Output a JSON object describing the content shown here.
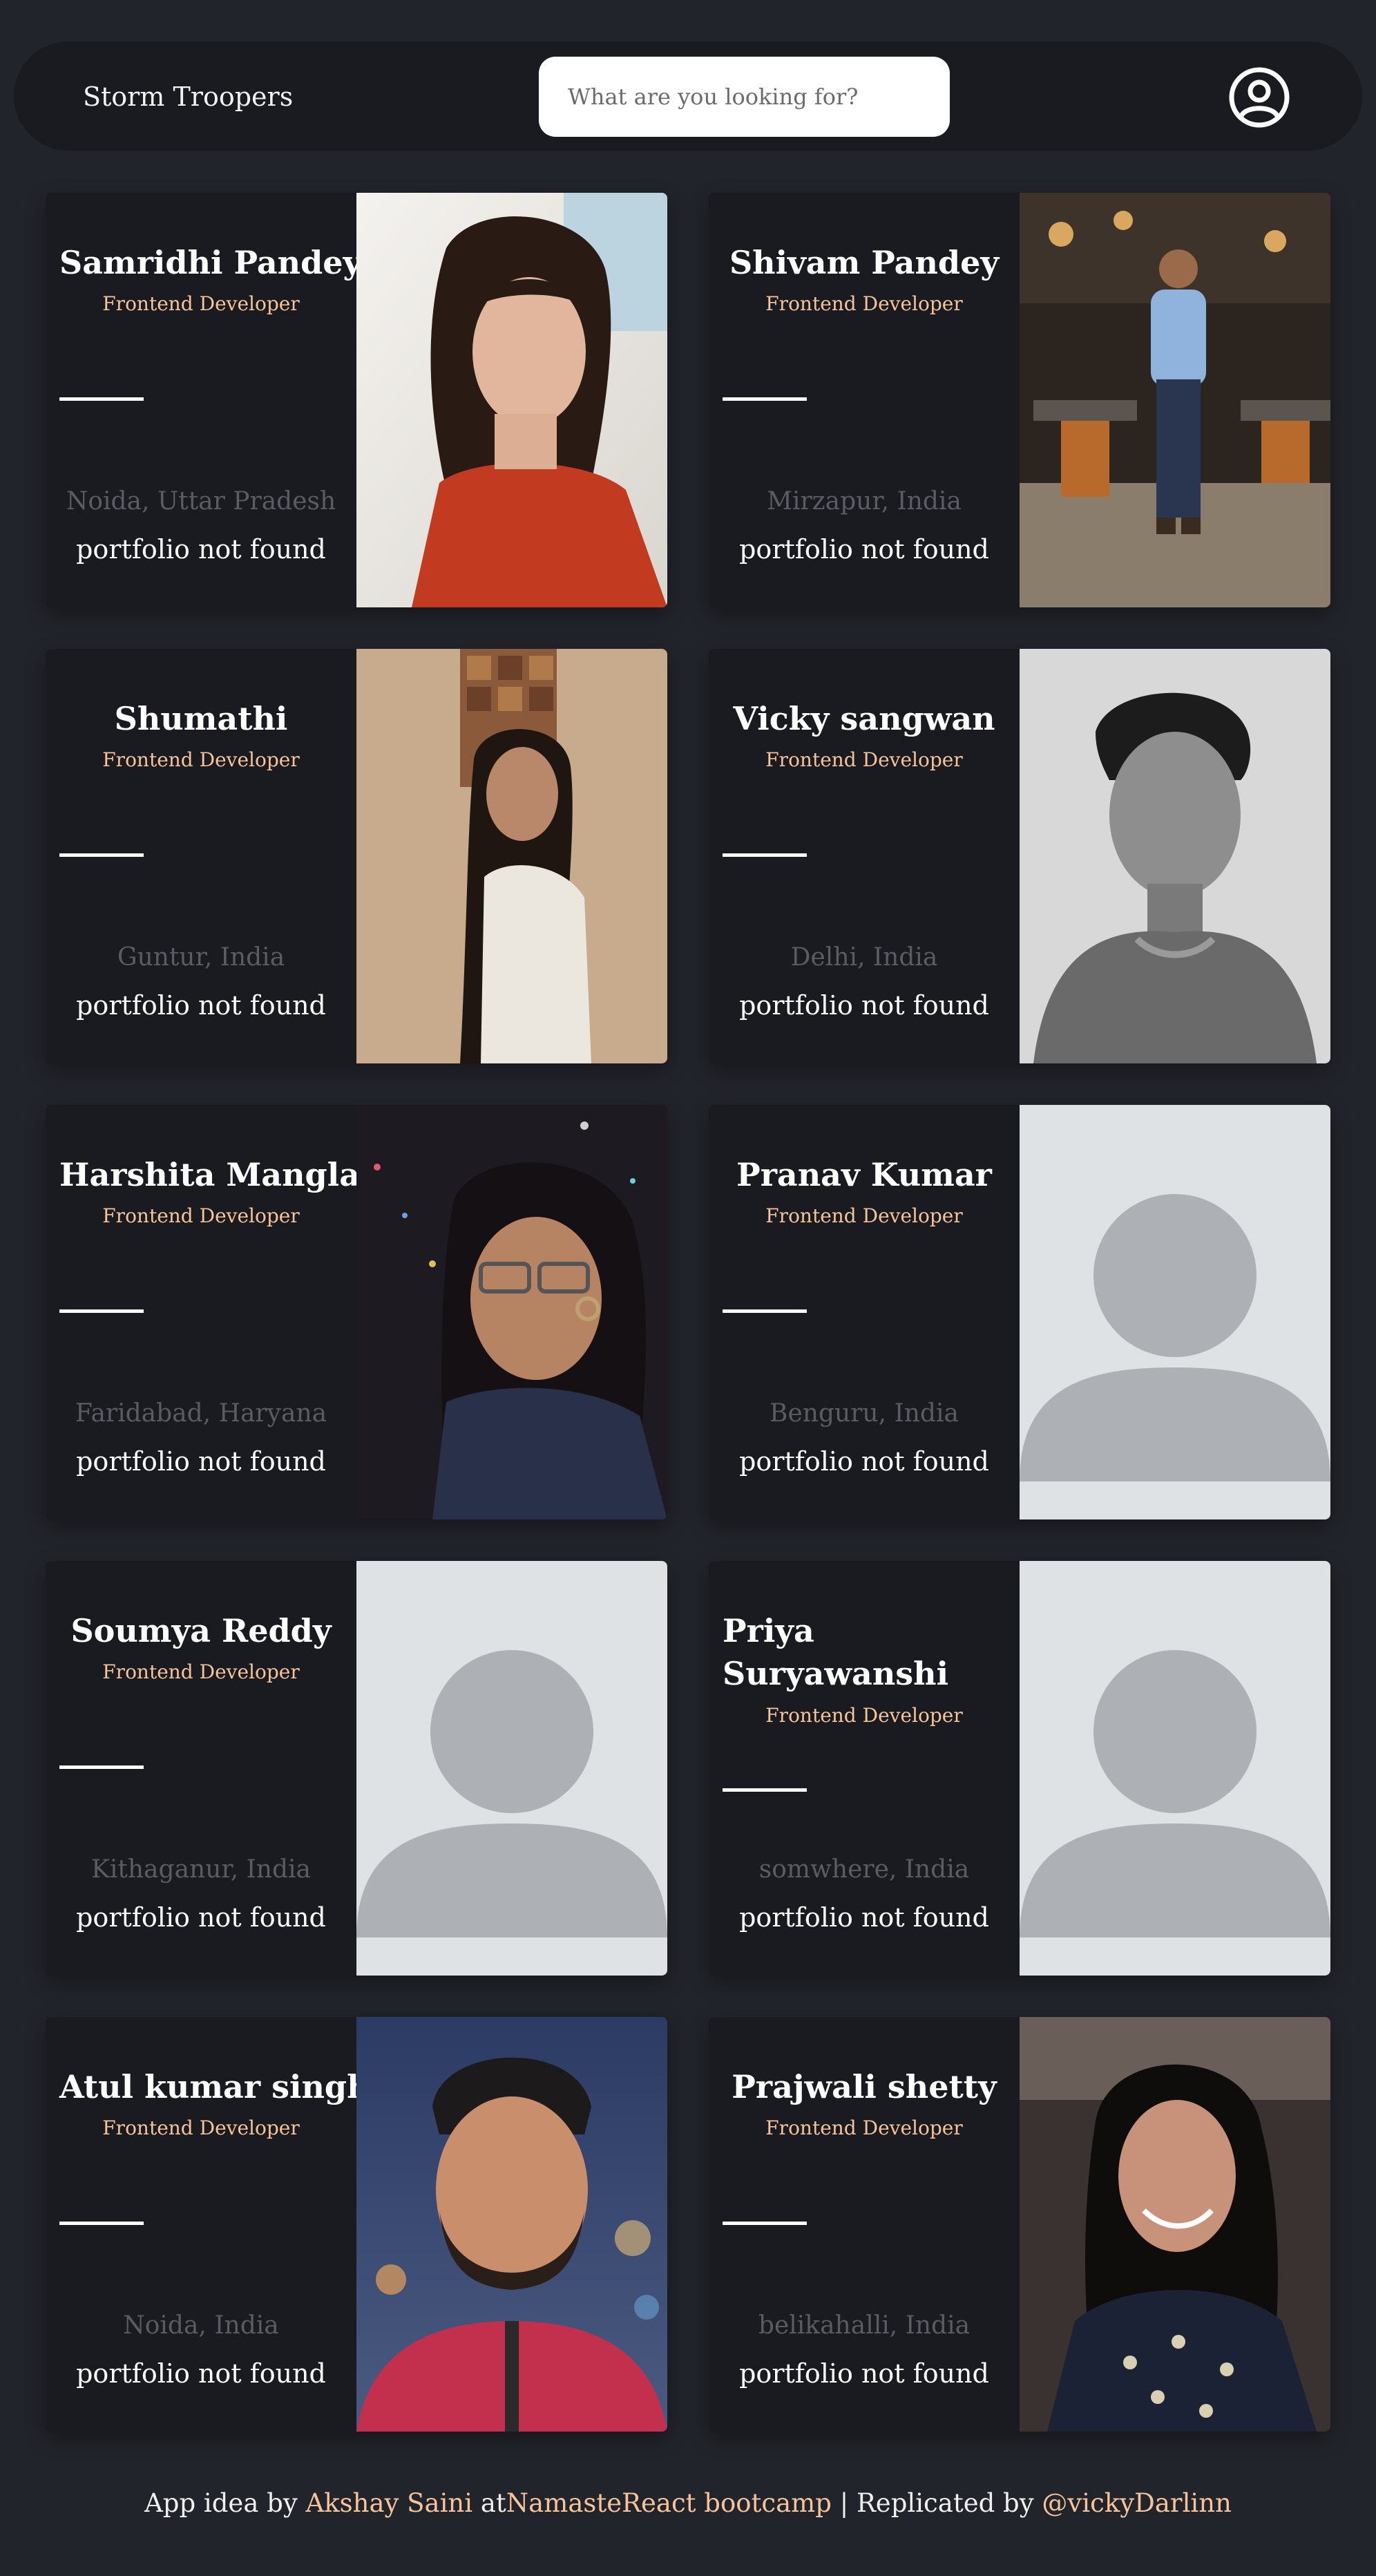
{
  "header": {
    "brand": "Storm Troopers",
    "search_placeholder": "What are you looking for?",
    "user_icon": "user-circle-icon"
  },
  "colors": {
    "background": "#22242b",
    "card": "#1a1b20",
    "accent": "#f7c49a",
    "muted": "#5a5c63"
  },
  "cards": [
    {
      "name": "Samridhi Pandey",
      "role": "Frontend Developer",
      "location": "Noida, Uttar Pradesh",
      "portfolio": "portfolio not found",
      "photo": "woman-portrait-red-top"
    },
    {
      "name": "Shivam Pandey",
      "role": "Frontend Developer",
      "location": "Mirzapur, India",
      "portfolio": "portfolio not found",
      "photo": "man-standing-restaurant"
    },
    {
      "name": "Shumathi",
      "role": "Frontend Developer",
      "location": "Guntur, India",
      "portfolio": "portfolio not found",
      "photo": "woman-portrait-beige-wall"
    },
    {
      "name": "Vicky sangwan",
      "role": "Frontend Developer",
      "location": "Delhi, India",
      "portfolio": "portfolio not found",
      "photo": "man-portrait-grayscale"
    },
    {
      "name": "Harshita Mangla",
      "role": "Frontend Developer",
      "location": "Faridabad, Haryana",
      "portfolio": "portfolio not found",
      "photo": "woman-glasses-night"
    },
    {
      "name": "Pranav Kumar",
      "role": "Frontend Developer",
      "location": "Benguru, India",
      "portfolio": "portfolio not found",
      "photo": "default-avatar"
    },
    {
      "name": "Soumya Reddy",
      "role": "Frontend Developer",
      "location": "Kithaganur, India",
      "portfolio": "portfolio not found",
      "photo": "default-avatar"
    },
    {
      "name": "Priya Suryawanshi",
      "role": "Frontend Developer",
      "location": "somwhere, India",
      "portfolio": "portfolio not found",
      "photo": "default-avatar"
    },
    {
      "name": "Atul kumar singh",
      "role": "Frontend Developer",
      "location": "Noida, India",
      "portfolio": "portfolio not found",
      "photo": "man-beard-red-shirt"
    },
    {
      "name": "Prajwali shetty",
      "role": "Frontend Developer",
      "location": "belikahalli, India",
      "portfolio": "portfolio not found",
      "photo": "woman-smiling-dark-hair"
    }
  ],
  "footer": {
    "prefix": "App idea by ",
    "author": "Akshay Saini",
    "at": " at",
    "bootcamp": "NamasteReact bootcamp",
    "separator": " | Replicated by ",
    "replicator": "@vickyDarlinn"
  }
}
